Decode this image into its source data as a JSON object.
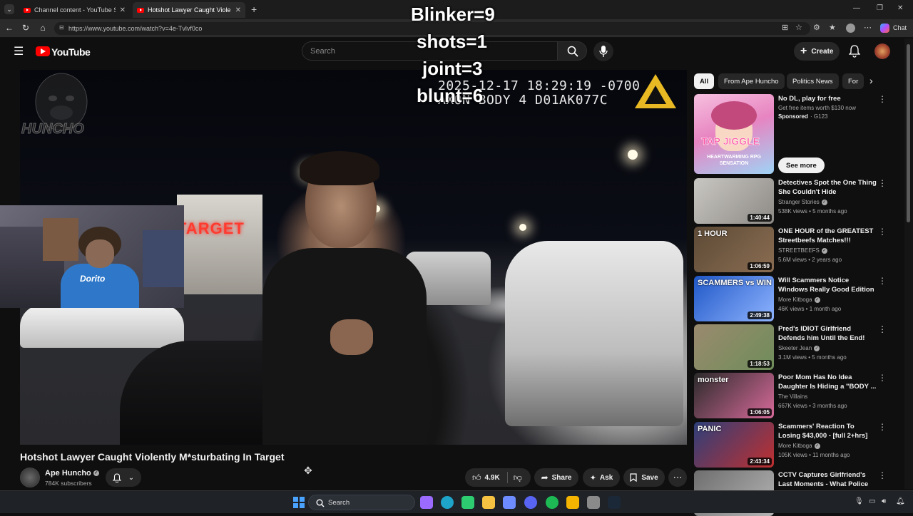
{
  "browser": {
    "tabs": [
      {
        "title": "Channel content - YouTube Studio",
        "active": false
      },
      {
        "title": "Hotshot Lawyer Caught Violently M",
        "active": true
      }
    ],
    "new_tab": "+",
    "url": "https://www.youtube.com/watch?v=4e-Tvlvf0co",
    "copilot_label": "Chat",
    "window_controls": [
      "—",
      "❐",
      "✕"
    ]
  },
  "youtube": {
    "logo_text": "YouTube",
    "search_placeholder": "Search",
    "create_label": "Create"
  },
  "overlay": {
    "counters": [
      "Blinker=9",
      "shots=1",
      "joint=3",
      "blunt=6"
    ]
  },
  "video": {
    "bodycam_timestamp": "2025-12-17 18:29:19 -0700",
    "bodycam_id": "AXON BODY 4 D01AK077C",
    "watermark_text": "HUNCHO",
    "store_sign": "TARGET",
    "webcam_shirt_text": "Dorito"
  },
  "meta": {
    "title": "Hotshot Lawyer Caught Violently M*sturbating In Target",
    "channel_name": "Ape Huncho",
    "subscribers": "784K subscribers",
    "likes": "4.9K",
    "share_label": "Share",
    "ask_label": "Ask",
    "save_label": "Save"
  },
  "sidebar": {
    "chips": [
      "All",
      "From Ape Huncho",
      "Politics News",
      "For"
    ],
    "ad": {
      "title": "No DL, play for free",
      "subtitle": "Get free items worth $130 now",
      "sponsored": "Sponsored",
      "advertiser": "G123",
      "cta": "See more",
      "thumb_text": "TAP JIGGLE",
      "thumb_text2": "HEARTWARMING RPG SENSATION"
    },
    "recommendations": [
      {
        "title": "Detectives Spot the One Thing She Couldn't Hide",
        "channel": "Stranger Stories",
        "verified": true,
        "meta": "538K views • 5 months ago",
        "duration": "1:40:44",
        "thumb_text": "",
        "colors": [
          "#c9c7c2",
          "#8d8a86"
        ]
      },
      {
        "title": "ONE HOUR of the GREATEST Streetbeefs Matches!!!",
        "channel": "STREETBEEFS",
        "verified": true,
        "meta": "5.6M views • 2 years ago",
        "duration": "1:06:59",
        "thumb_text": "1 HOUR",
        "colors": [
          "#5d4a36",
          "#8a6d52"
        ]
      },
      {
        "title": "Will Scammers Notice Windows Really Good Edition - [full ...",
        "channel": "More Kitboga",
        "verified": true,
        "meta": "46K views • 1 month ago",
        "duration": "2:49:38",
        "thumb_text": "SCAMMERS vs WIN",
        "colors": [
          "#1f57c7",
          "#8fb4ff"
        ]
      },
      {
        "title": "Pred's IDIOT Girlfriend Defends him Until the End!",
        "channel": "Skeeter Jean",
        "verified": true,
        "meta": "3.1M views • 5 months ago",
        "duration": "1:18:53",
        "thumb_text": "",
        "colors": [
          "#9a8a6e",
          "#6f8d5a"
        ]
      },
      {
        "title": "Poor Mom Has No Idea Daughter Is Hiding a \"BODY ...",
        "channel": "The Villains",
        "verified": false,
        "meta": "667K views • 3 months ago",
        "duration": "1:06:05",
        "thumb_text": "monster",
        "colors": [
          "#2a2a2a",
          "#d86a9a"
        ]
      },
      {
        "title": "Scammers' Reaction To Losing $43,000 - [full 2+hrs]",
        "channel": "More Kitboga",
        "verified": true,
        "meta": "105K views • 11 months ago",
        "duration": "2:43:34",
        "thumb_text": "PANIC",
        "colors": [
          "#2d3f7a",
          "#c03030"
        ]
      },
      {
        "title": "CCTV Captures Girlfriend's Last Moments - What Police Find ...",
        "channel": "",
        "verified": false,
        "meta": "",
        "duration": "",
        "thumb_text": "",
        "colors": [
          "#6e6e6e",
          "#b5b5b5"
        ]
      }
    ]
  },
  "taskbar": {
    "search_label": "Search",
    "icons": [
      "windows-start-icon",
      "search-icon",
      "copilot-icon",
      "edge-icon",
      "app-icon",
      "file-explorer-icon",
      "store-icon",
      "discord-icon",
      "spotify-icon",
      "rockstar-icon",
      "app2-icon",
      "steam-icon"
    ],
    "icon_colors": [
      "#4aa3ff",
      "#ffffff",
      "#9b6bff",
      "#1ea3c9",
      "#2ecc71",
      "#f5c242",
      "#6d8cff",
      "#5865f2",
      "#1db954",
      "#f4b400",
      "#8a8a8a",
      "#1b2838"
    ]
  }
}
